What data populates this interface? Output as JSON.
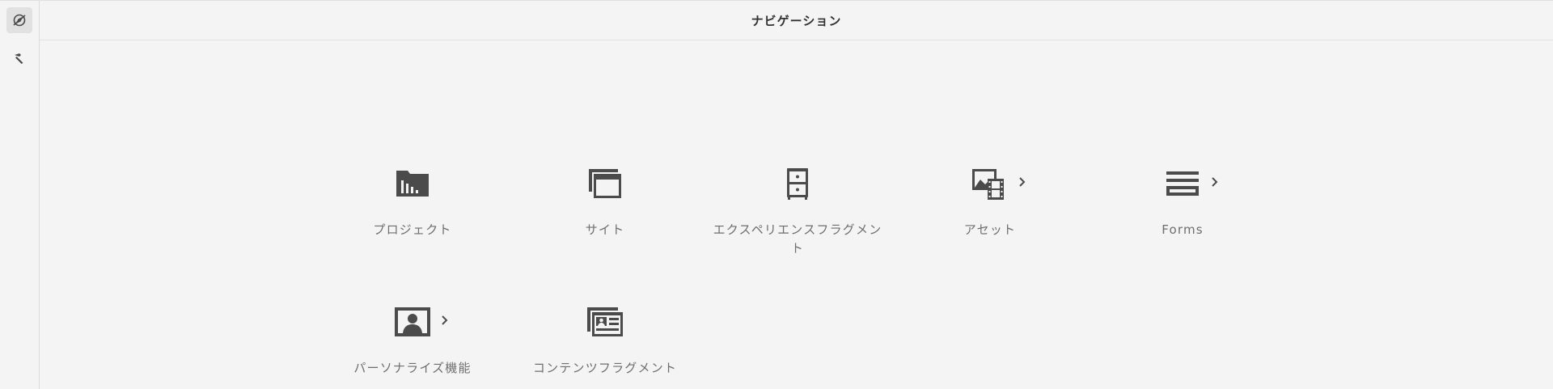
{
  "header": {
    "title": "ナビゲーション"
  },
  "rail": {
    "items": [
      {
        "icon": "compass-off-icon",
        "active": true
      },
      {
        "icon": "hammer-icon",
        "active": false
      }
    ]
  },
  "tiles": [
    {
      "label": "プロジェクト",
      "icon": "projects-folder-icon",
      "has_children": false
    },
    {
      "label": "サイト",
      "icon": "sites-windows-icon",
      "has_children": false
    },
    {
      "label": "エクスペリエンスフラグメント",
      "icon": "cabinet-icon",
      "has_children": false
    },
    {
      "label": "アセット",
      "icon": "assets-image-film-icon",
      "has_children": true
    },
    {
      "label": "Forms",
      "icon": "forms-lines-icon",
      "has_children": true
    },
    {
      "label": "パーソナライズ機能",
      "icon": "personalization-portrait-icon",
      "has_children": true
    },
    {
      "label": "コンテンツフラグメント",
      "icon": "content-fragment-card-icon",
      "has_children": false
    }
  ],
  "colors": {
    "background": "#f4f4f4",
    "icon": "#4b4b4b",
    "label": "#6e6e6e",
    "title": "#323232"
  }
}
